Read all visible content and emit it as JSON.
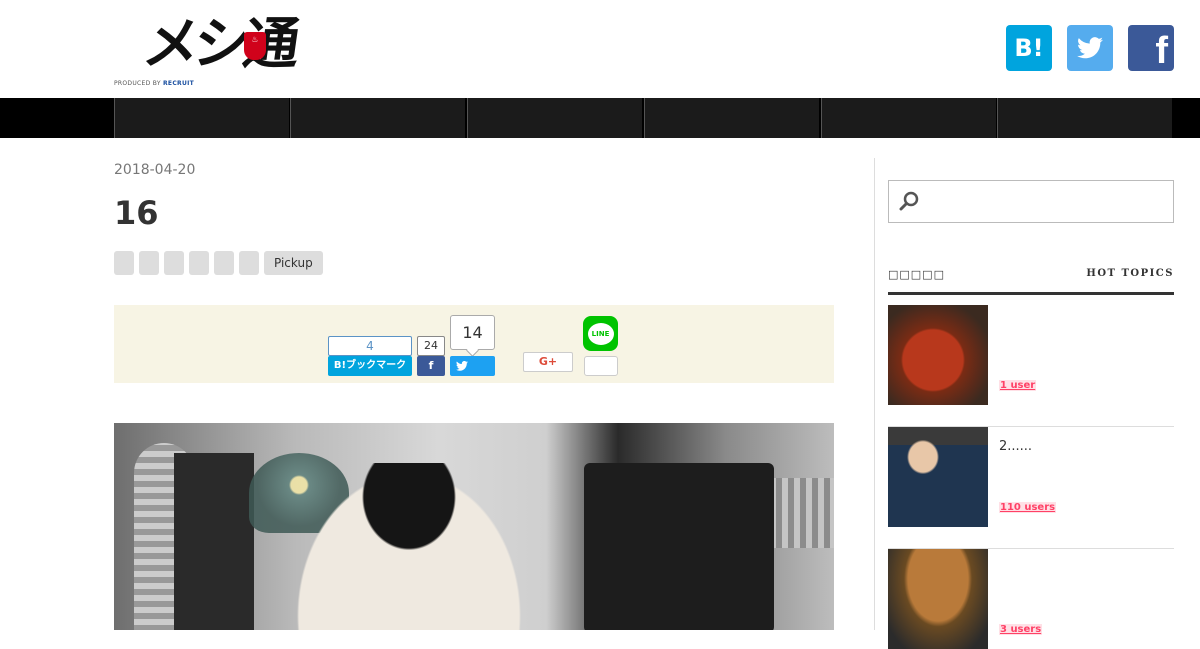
{
  "header": {
    "logo_text": "メシ通",
    "logo_produced_prefix": "PRODUCED BY ",
    "logo_produced_brand": "RECRUIT",
    "social": {
      "hatena_label": "B!",
      "twitter_label": "",
      "facebook_label": "f"
    }
  },
  "nav": {
    "items": [
      "",
      "",
      "",
      "",
      "",
      ""
    ]
  },
  "article": {
    "date": "2018-04-20",
    "title": "16",
    "tags": [
      "",
      "",
      "",
      "",
      "",
      "",
      "Pickup"
    ],
    "share": {
      "hatena_count": "4",
      "hatena_label": "B!ブックマーク",
      "facebook_count": "24",
      "twitter_count": "14",
      "googleplus_label": "G+",
      "line_label": "LINE",
      "line_count": ""
    }
  },
  "sidebar": {
    "search_placeholder": "",
    "hot_topics_title_jp": "□□□□□",
    "hot_topics_title_en": "HOT TOPICS",
    "topics": [
      {
        "title": "",
        "users": "1 user"
      },
      {
        "title": "2......",
        "users": "110 users"
      },
      {
        "title": "",
        "users": "3 users"
      }
    ]
  },
  "colors": {
    "hatena": "#00a4de",
    "twitter": "#55acee",
    "facebook": "#3b5998",
    "line": "#00c300",
    "users_badge": "#ff4166"
  }
}
